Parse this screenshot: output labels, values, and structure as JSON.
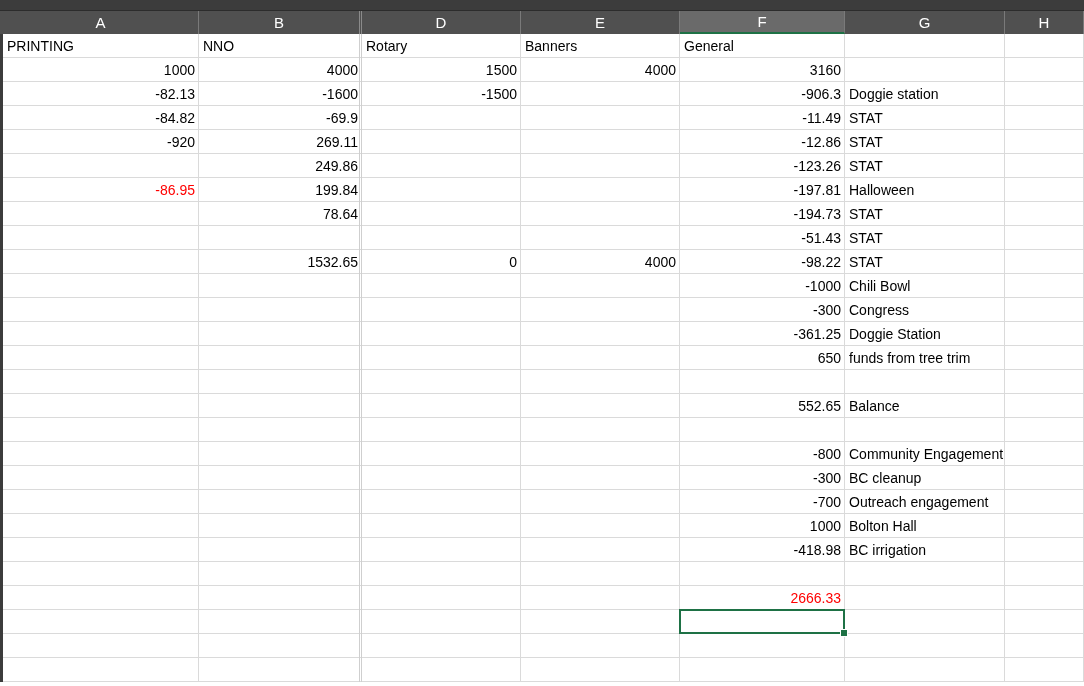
{
  "columns": [
    {
      "label": "A",
      "selected": false
    },
    {
      "label": "B",
      "selected": false
    },
    {
      "label": "D",
      "selected": false
    },
    {
      "label": "E",
      "selected": false
    },
    {
      "label": "F",
      "selected": true
    },
    {
      "label": "G",
      "selected": false
    },
    {
      "label": "H",
      "selected": false
    }
  ],
  "rows": [
    {
      "cells": [
        {
          "kind": "text",
          "text": "PRINTING",
          "selected": false
        },
        {
          "kind": "text",
          "text": "NNO",
          "selected": false
        },
        {
          "kind": "text",
          "text": "Rotary",
          "selected": false
        },
        {
          "kind": "text",
          "text": "Banners",
          "selected": false
        },
        {
          "kind": "text",
          "text": "General",
          "selected": false
        },
        null,
        null
      ]
    },
    {
      "cells": [
        {
          "kind": "number",
          "text": "1000",
          "selected": false
        },
        {
          "kind": "number",
          "text": "4000",
          "selected": false
        },
        {
          "kind": "number",
          "text": "1500",
          "selected": false
        },
        {
          "kind": "number",
          "text": "4000",
          "selected": false
        },
        {
          "kind": "number",
          "text": "3160",
          "selected": false
        },
        null,
        null
      ]
    },
    {
      "cells": [
        {
          "kind": "number",
          "text": "-82.13",
          "selected": false
        },
        {
          "kind": "number",
          "text": "-1600",
          "selected": false
        },
        {
          "kind": "number",
          "text": "-1500",
          "selected": false
        },
        null,
        {
          "kind": "number",
          "text": "-906.3",
          "selected": false
        },
        {
          "kind": "text",
          "text": "Doggie station",
          "selected": false
        },
        null
      ]
    },
    {
      "cells": [
        {
          "kind": "number",
          "text": "-84.82",
          "selected": false
        },
        {
          "kind": "number",
          "text": "-69.9",
          "selected": false
        },
        null,
        null,
        {
          "kind": "number",
          "text": "-11.49",
          "selected": false
        },
        {
          "kind": "text",
          "text": "STAT",
          "selected": false
        },
        null
      ]
    },
    {
      "cells": [
        {
          "kind": "number",
          "text": "-920",
          "selected": false
        },
        {
          "kind": "number",
          "text": "269.11",
          "selected": false
        },
        null,
        null,
        {
          "kind": "number",
          "text": "-12.86",
          "selected": false
        },
        {
          "kind": "text",
          "text": "STAT",
          "selected": false
        },
        null
      ]
    },
    {
      "cells": [
        null,
        {
          "kind": "number",
          "text": "249.86",
          "selected": false
        },
        null,
        null,
        {
          "kind": "number",
          "text": "-123.26",
          "selected": false
        },
        {
          "kind": "text",
          "text": "STAT",
          "selected": false
        },
        null
      ]
    },
    {
      "cells": [
        {
          "kind": "number",
          "text": "-86.95",
          "color": "#ff0000",
          "selected": false
        },
        {
          "kind": "number",
          "text": "199.84",
          "selected": false
        },
        null,
        null,
        {
          "kind": "number",
          "text": "-197.81",
          "selected": false
        },
        {
          "kind": "text",
          "text": "Halloween",
          "selected": false
        },
        null
      ]
    },
    {
      "cells": [
        null,
        {
          "kind": "number",
          "text": "78.64",
          "selected": false
        },
        null,
        null,
        {
          "kind": "number",
          "text": "-194.73",
          "selected": false
        },
        {
          "kind": "text",
          "text": "STAT",
          "selected": false
        },
        null
      ]
    },
    {
      "cells": [
        null,
        null,
        null,
        null,
        {
          "kind": "number",
          "text": "-51.43",
          "selected": false
        },
        {
          "kind": "text",
          "text": "STAT",
          "selected": false
        },
        null
      ]
    },
    {
      "cells": [
        null,
        {
          "kind": "number",
          "text": "1532.65",
          "selected": false
        },
        {
          "kind": "number",
          "text": "0",
          "selected": false
        },
        {
          "kind": "number",
          "text": "4000",
          "selected": false
        },
        {
          "kind": "number",
          "text": "-98.22",
          "selected": false
        },
        {
          "kind": "text",
          "text": "STAT",
          "selected": false
        },
        null
      ]
    },
    {
      "cells": [
        null,
        null,
        null,
        null,
        {
          "kind": "number",
          "text": "-1000",
          "selected": false
        },
        {
          "kind": "text",
          "text": "Chili Bowl",
          "selected": false
        },
        null
      ]
    },
    {
      "cells": [
        null,
        null,
        null,
        null,
        {
          "kind": "number",
          "text": "-300",
          "selected": false
        },
        {
          "kind": "text",
          "text": "Congress",
          "selected": false
        },
        null
      ]
    },
    {
      "cells": [
        null,
        null,
        null,
        null,
        {
          "kind": "number",
          "text": "-361.25",
          "selected": false
        },
        {
          "kind": "text",
          "text": "Doggie Station",
          "selected": false
        },
        null
      ]
    },
    {
      "cells": [
        null,
        null,
        null,
        null,
        {
          "kind": "number",
          "text": "650",
          "selected": false
        },
        {
          "kind": "text",
          "text": "funds from tree trim",
          "selected": false
        },
        null
      ]
    },
    {},
    {
      "cells": [
        null,
        null,
        null,
        null,
        {
          "kind": "number",
          "text": "552.65",
          "selected": false
        },
        {
          "kind": "text",
          "text": "Balance",
          "selected": false
        },
        null
      ]
    },
    {},
    {
      "cells": [
        null,
        null,
        null,
        null,
        {
          "kind": "number",
          "text": "-800",
          "selected": false
        },
        {
          "kind": "text",
          "text": "Community Engagement",
          "selected": false
        },
        null
      ]
    },
    {
      "cells": [
        null,
        null,
        null,
        null,
        {
          "kind": "number",
          "text": "-300",
          "selected": false
        },
        {
          "kind": "text",
          "text": "BC cleanup",
          "selected": false
        },
        null
      ]
    },
    {
      "cells": [
        null,
        null,
        null,
        null,
        {
          "kind": "number",
          "text": "-700",
          "selected": false
        },
        {
          "kind": "text",
          "text": "Outreach engagement",
          "selected": false
        },
        null
      ]
    },
    {
      "cells": [
        null,
        null,
        null,
        null,
        {
          "kind": "number",
          "text": "1000",
          "selected": false
        },
        {
          "kind": "text",
          "text": "Bolton Hall",
          "selected": false
        },
        null
      ]
    },
    {
      "cells": [
        null,
        null,
        null,
        null,
        {
          "kind": "number",
          "text": "-418.98",
          "selected": false
        },
        {
          "kind": "text",
          "text": "BC irrigation",
          "selected": false
        },
        null
      ]
    },
    {},
    {
      "cells": [
        null,
        null,
        null,
        null,
        {
          "kind": "number",
          "text": "2666.33",
          "color": "#ff0000",
          "selected": false
        },
        null,
        null
      ]
    },
    {
      "cells": [
        null,
        null,
        null,
        null,
        {
          "kind": "blank",
          "selected": true
        },
        null,
        null
      ]
    },
    {},
    {}
  ]
}
